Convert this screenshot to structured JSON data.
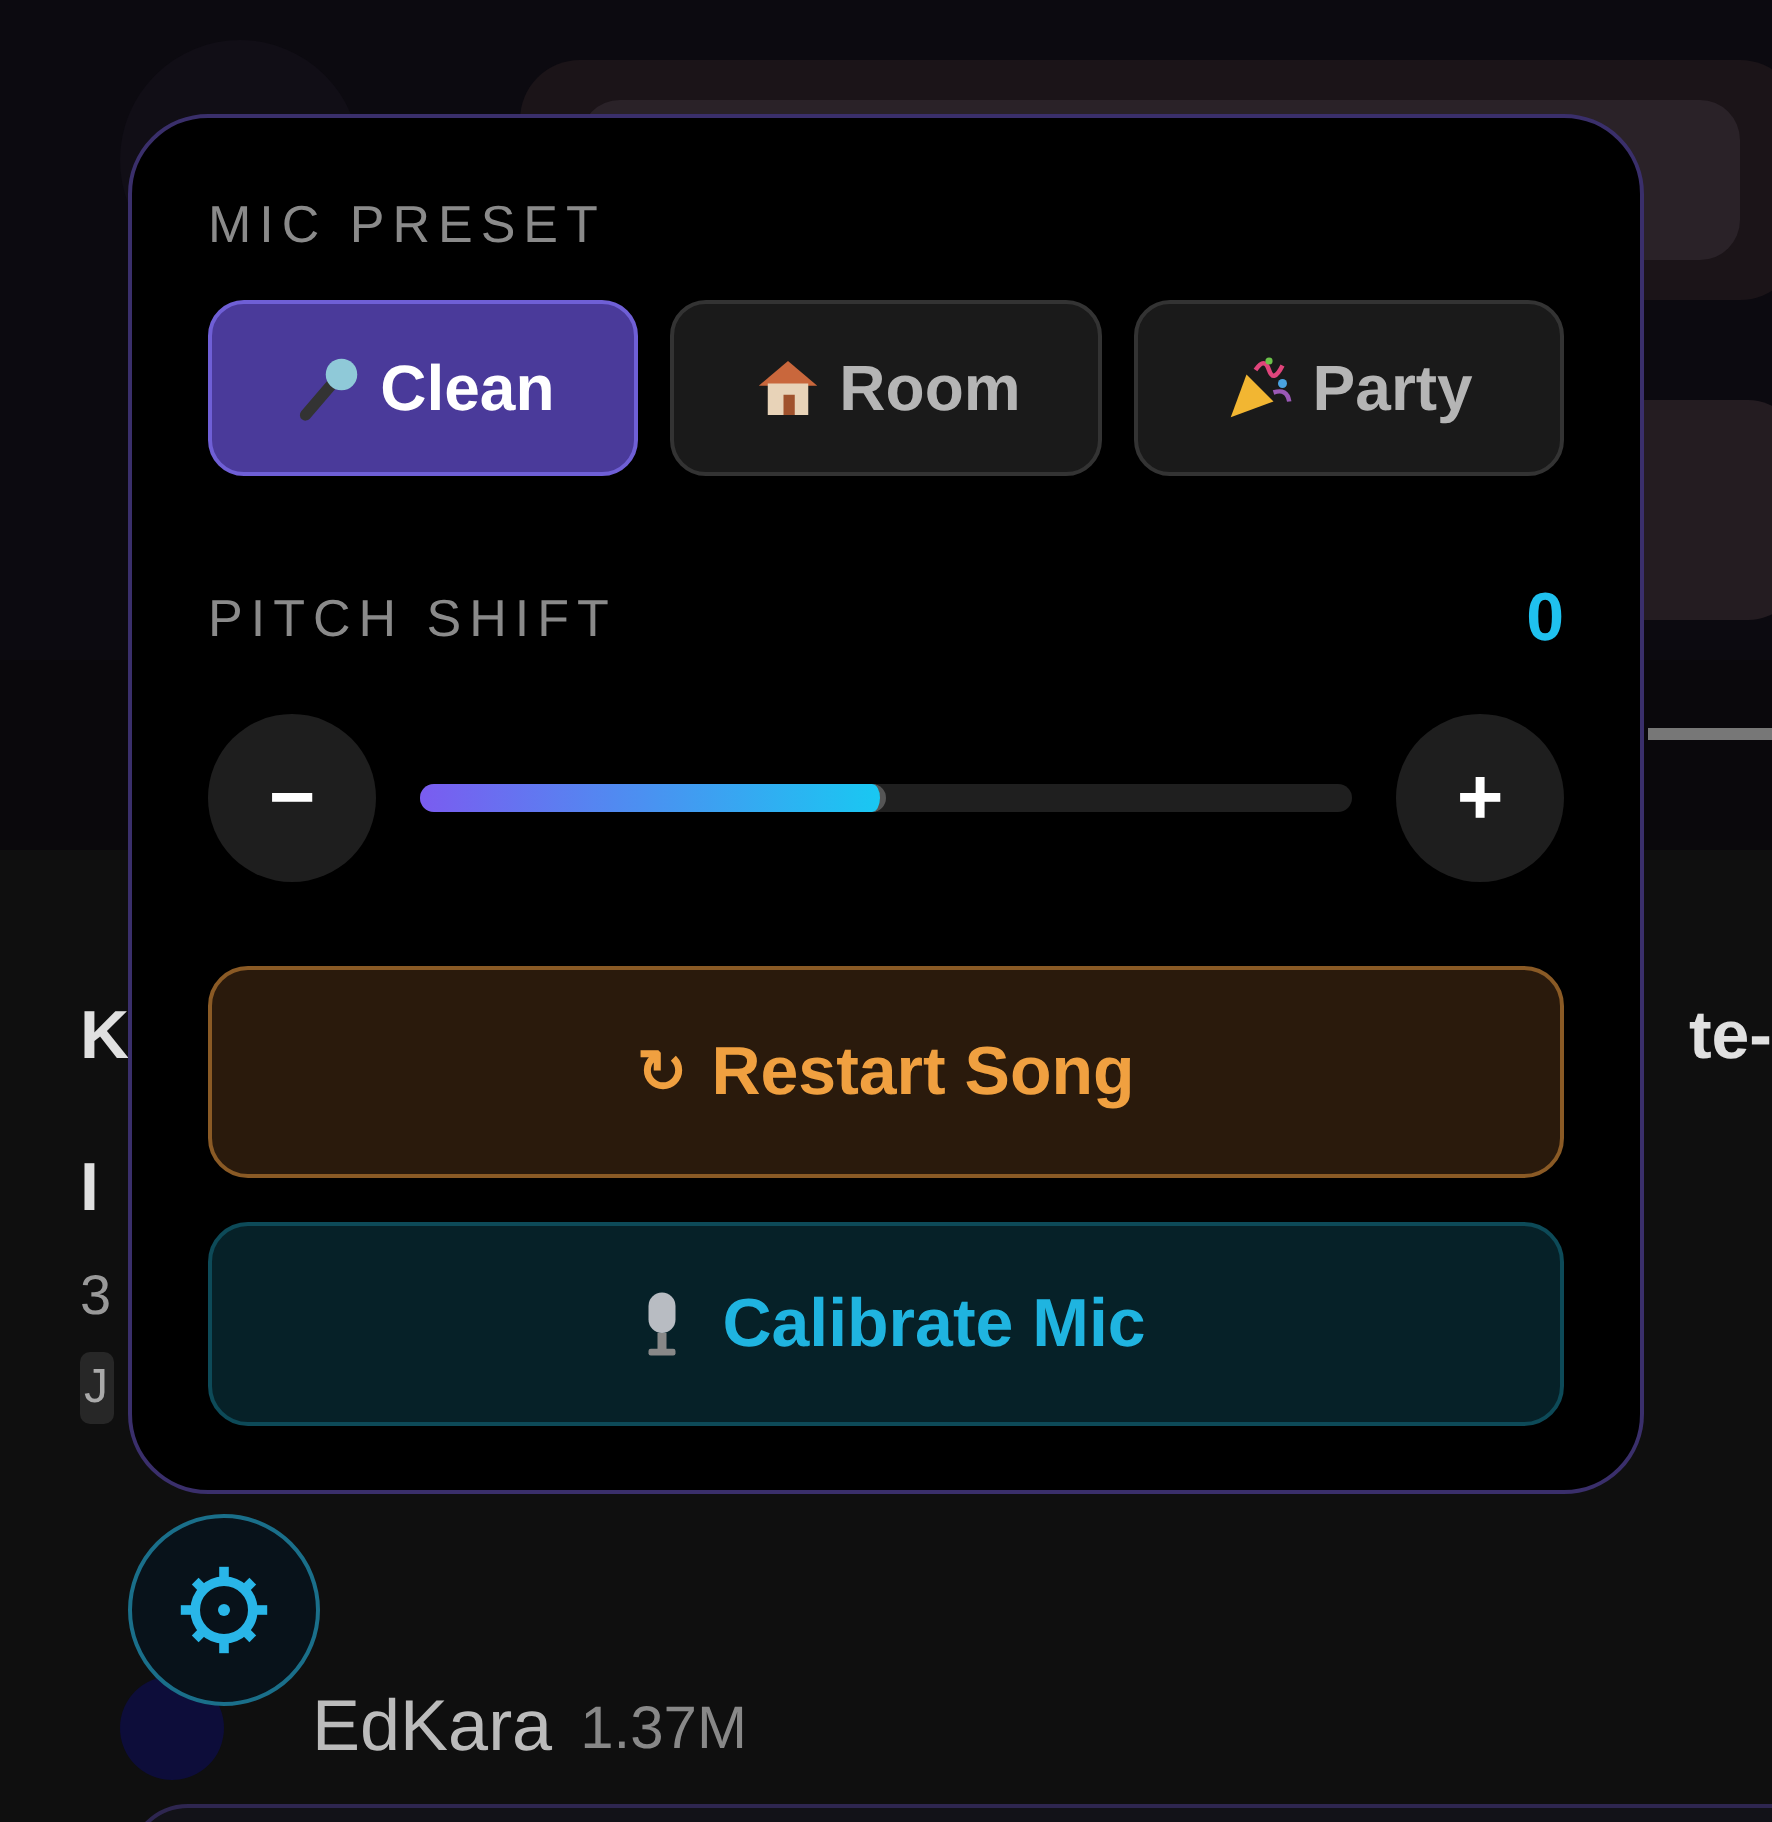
{
  "details": {
    "title_line_1_start": "K",
    "title_line_1_end": "te-",
    "title_line_2_start": "I",
    "meta_start": "3",
    "description_start": "J",
    "channel": "EdKara",
    "subscribers": "1.37M"
  },
  "panel": {
    "mic_preset": {
      "label": "MIC PRESET",
      "presets": [
        {
          "kind": "clean",
          "label": "Clean",
          "selected": true
        },
        {
          "kind": "room",
          "label": "Room",
          "selected": false
        },
        {
          "kind": "party",
          "label": "Party",
          "selected": false
        }
      ]
    },
    "pitch_shift": {
      "label": "PITCH SHIFT",
      "value": "0",
      "minus": "−",
      "plus": "+",
      "level": 0.5
    },
    "actions": [
      {
        "kind": "restart",
        "icon": "↻",
        "label": "Restart Song"
      },
      {
        "kind": "calibrate",
        "label": "Calibrate Mic"
      }
    ]
  }
}
